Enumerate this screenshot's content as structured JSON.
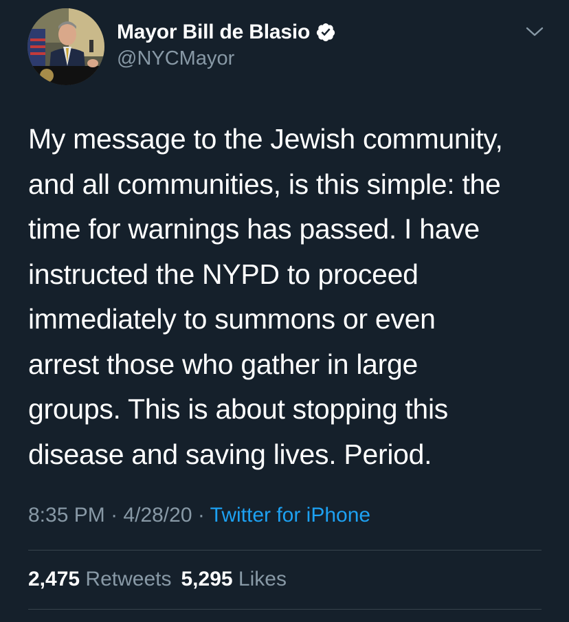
{
  "author": {
    "display_name": "Mayor Bill de Blasio",
    "handle": "@NYCMayor",
    "verified": true
  },
  "icons": {
    "verified": "verified-badge-icon",
    "menu": "chevron-down-icon"
  },
  "tweet": {
    "text": "My message to the Jewish community,\nand all communities, is this simple: the\ntime for warnings has passed. I have\ninstructed the NYPD to proceed\nimmediately to summons or even\narrest those who gather in large\ngroups. This is about stopping this\ndisease and saving lives. Period.",
    "time": "8:35 PM",
    "separator": "·",
    "date": "4/28/20",
    "source": "Twitter for iPhone"
  },
  "stats": {
    "retweets_count": "2,475",
    "retweets_label": "Retweets",
    "likes_count": "5,295",
    "likes_label": "Likes"
  },
  "colors": {
    "background": "#15202b",
    "text": "#ffffff",
    "secondary_text": "#8899a6",
    "link": "#1da1f2",
    "divider": "#38444d"
  }
}
